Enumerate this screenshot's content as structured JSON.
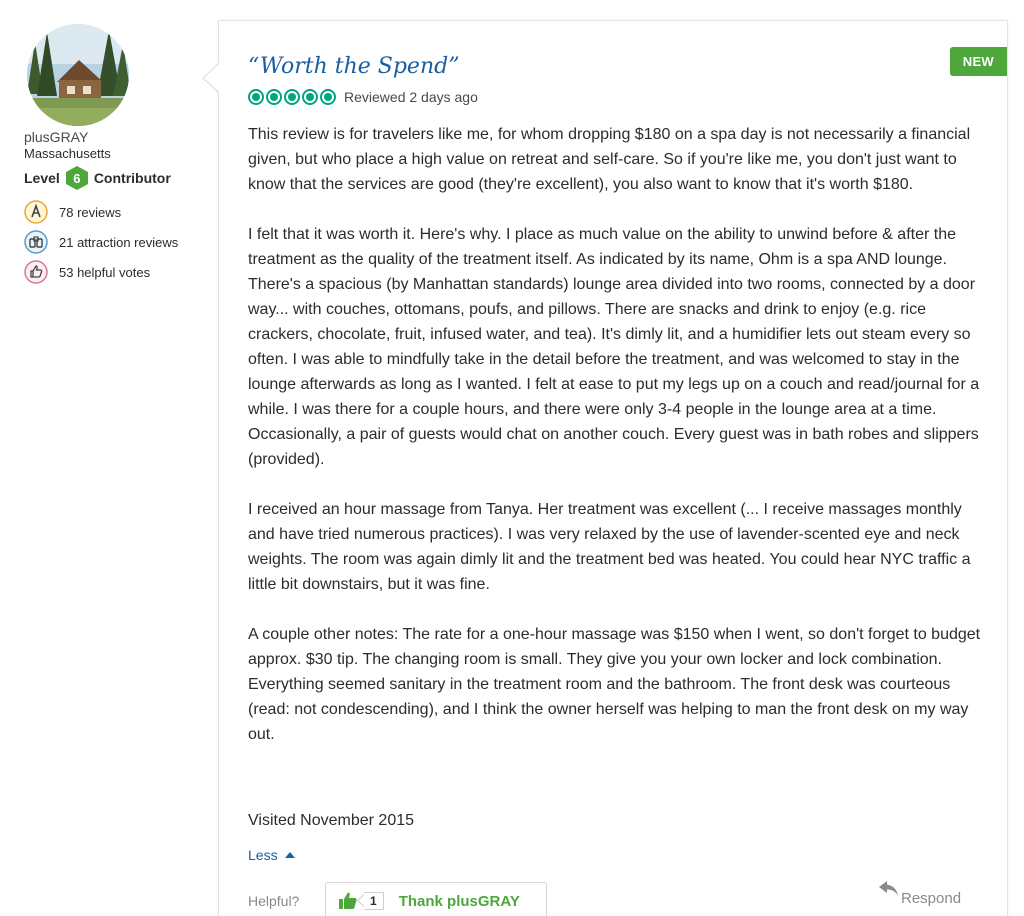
{
  "reviewer": {
    "username": "plusGRAY",
    "location": "Massachusetts",
    "level_prefix": "Level",
    "level": "6",
    "level_suffix": "Contributor",
    "stats": [
      {
        "icon": "reviews-pencil-icon",
        "text": "78 reviews"
      },
      {
        "icon": "attraction-binoculars-icon",
        "text": "21 attraction reviews"
      },
      {
        "icon": "thumbs-up-icon",
        "text": "53 helpful votes"
      }
    ]
  },
  "review": {
    "badge": "NEW",
    "title": "“Worth the Spend”",
    "rating": 5,
    "reviewed": "Reviewed 2 days ago",
    "paragraphs": [
      "This review is for travelers like me, for whom dropping $180 on a spa day is not necessarily a financial given, but who place a high value on retreat and self-care. So if you're like me, you don't just want to know that the services are good (they're excellent), you also want to know that it's worth $180.",
      "I felt that it was worth it. Here's why. I place as much value on the ability to unwind before & after the treatment as the quality of the treatment itself. As indicated by its name, Ohm is a spa AND lounge. There's a spacious (by Manhattan standards) lounge area divided into two rooms, connected by a door way... with couches, ottomans, poufs, and pillows. There are snacks and drink to enjoy (e.g. rice crackers, chocolate, fruit, infused water, and tea). It's dimly lit, and a humidifier lets out steam every so often. I was able to mindfully take in the detail before the treatment, and was welcomed to stay in the lounge afterwards as long as I wanted. I felt at ease to put my legs up on a couch and read/journal for a while. I was there for a couple hours, and there were only 3-4 people in the lounge area at a time. Occasionally, a pair of guests would chat on another couch. Every guest was in bath robes and slippers (provided).",
      "I received an hour massage from Tanya. Her treatment was excellent (... I receive massages monthly and have tried numerous practices). I was very relaxed by the use of lavender-scented eye and neck weights. The room was again dimly lit and the treatment bed was heated. You could hear NYC traffic a little bit downstairs, but it was fine.",
      "A couple other notes: The rate for a one-hour massage was $150 when I went, so don't forget to budget approx. $30 tip. The changing room is small. They give you your own locker and lock combination. Everything seemed sanitary in the treatment room and the bathroom. The front desk was courteous (read: not condescending), and I think the owner herself was helping to man the front desk on my way out."
    ],
    "visited": "Visited November 2015",
    "less_label": "Less",
    "helpful_label": "Helpful?",
    "thank_count": "1",
    "thank_label": "Thank plusGRAY",
    "respond_label": "Respond"
  },
  "colors": {
    "link_blue": "#1a5fa0",
    "bubble_green": "#00a680",
    "badge_green": "#4da73b"
  }
}
